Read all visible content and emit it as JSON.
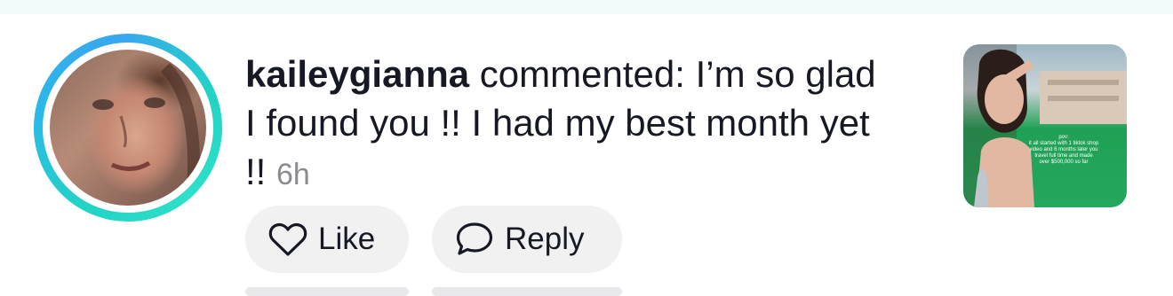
{
  "comment": {
    "username": "kaileygianna",
    "action": "commented:",
    "text": "I’m so glad I found you !! I had my best month yet !!",
    "time": "6h"
  },
  "actions": {
    "like_label": "Like",
    "reply_label": "Reply"
  },
  "thumbnail": {
    "overlay_lines": [
      "pov:",
      "it all started with 1 tiktok shop",
      "video and 6 months later you",
      "travel full time and made",
      "over $500,000 so far"
    ]
  },
  "colors": {
    "ring_gradient": [
      "#22d3c5",
      "#3aa6f0"
    ],
    "pill_bg": "#f1f1f2",
    "text": "#161823",
    "muted": "#8a8b91"
  },
  "icons": {
    "like": "heart-outline-icon",
    "reply": "speech-bubble-icon"
  }
}
